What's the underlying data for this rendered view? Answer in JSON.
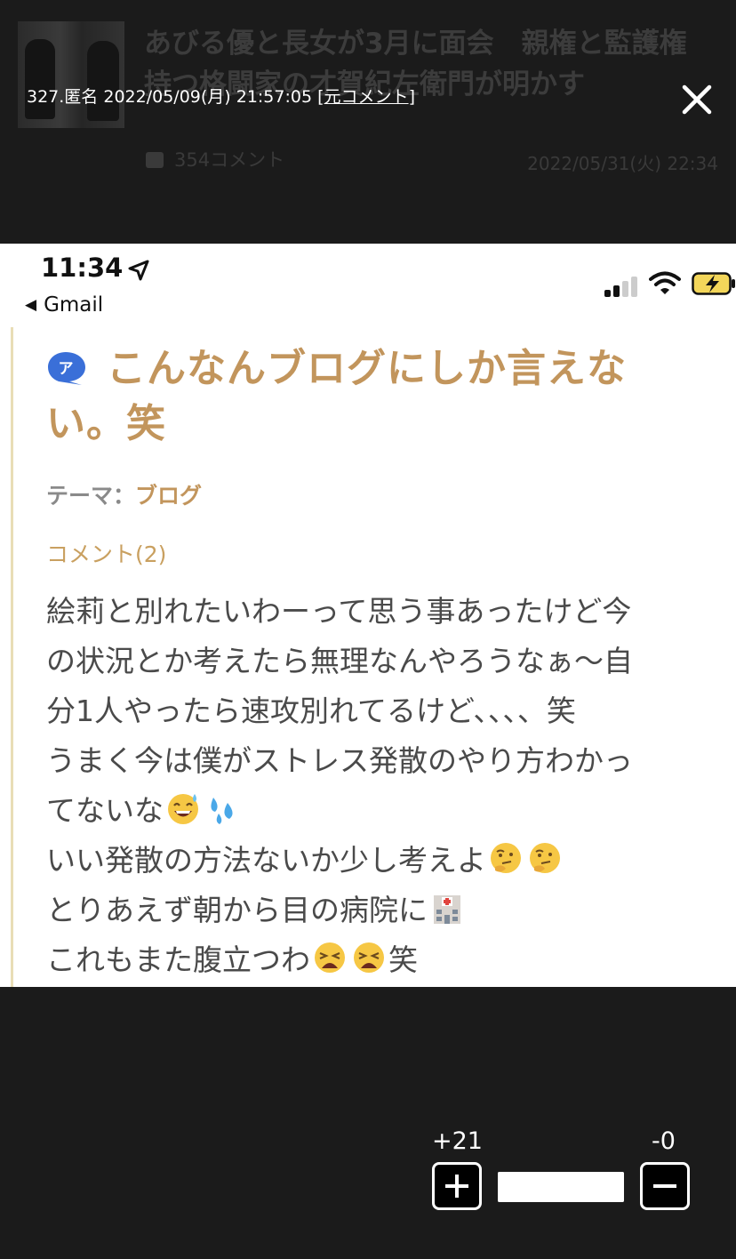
{
  "background_article": {
    "title": "あびる優と長女が3月に面会　親権と監護権持つ格闘家の才賀紀左衛門が明かす",
    "comment_count": "354コメント",
    "date": "2022/05/31(火) 22:34"
  },
  "comment": {
    "number_author": "327.匿名",
    "timestamp": "2022/05/09(月) 21:57:05",
    "original_link": "元コメント"
  },
  "screenshot": {
    "status_time": "11:34",
    "back_app": "Gmail",
    "blog_title": "こんなんブログにしか言えない。笑",
    "theme_label": "テーマ：",
    "theme_value": "ブログ",
    "comment_link": "コメント(2)",
    "body_lines": [
      "絵莉と別れたいわーって思う事あったけど今",
      "の状況とか考えたら無理なんやろうなぁ〜自",
      "分1人やったら速攻別れてるけど、、、、笑",
      "うまく今は僕がストレス発散のやり方わかっ",
      "てないな",
      "いい発散の方法ないか少し考えよ",
      "とりあえず朝から目の病院に",
      "これもまた腹立つわ",
      "笑"
    ]
  },
  "votes": {
    "plus": "+21",
    "minus": "-0",
    "plus_ratio": 1.0
  },
  "icons": {
    "close": "close-icon",
    "plus": "plus-icon",
    "minus": "minus-icon"
  }
}
